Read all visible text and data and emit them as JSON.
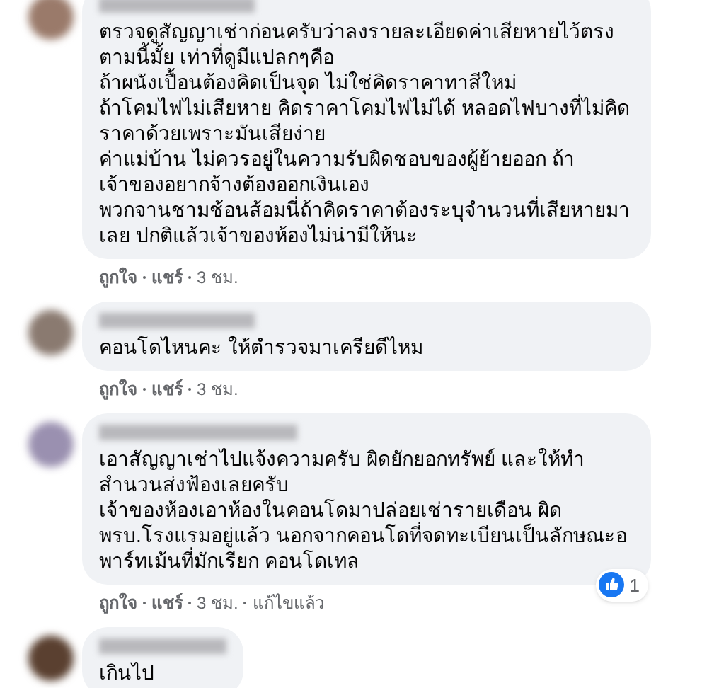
{
  "comments": [
    {
      "text": "ตรวจดูสัญญาเช่าก่อนครับว่าลงรายละเอียดค่าเสียหายไว้ตรงตามนี้มั้ย เท่าที่ดูมีแปลกๆคือ\nถ้าผนังเปื้อนต้องคิดเป็นจุด ไม่ใช่คิดราคาทาสีใหม่\nถ้าโคมไฟไม่เสียหาย คิดราคาโคมไฟไม่ได้ หลอดไฟบางที่ไม่คิดราคาด้วยเพราะมันเสียง่าย\nค่าแม่บ้าน ไม่ควรอยู่ในความรับผิดชอบของผู้ย้ายออก ถ้าเจ้าของอยากจ้างต้องออกเงินเอง\nพวกจานชามช้อนส้อมนี่ถ้าคิดราคาต้องระบุจำนวนที่เสียหายมาเลย ปกติแล้วเจ้าของห้องไม่น่ามีให้นะ",
      "actions": [
        {
          "label": "ถูกใจ",
          "kind": "link"
        },
        {
          "label": "แชร์",
          "kind": "link"
        },
        {
          "label": "3 ชม.",
          "kind": "time"
        }
      ]
    },
    {
      "text": "คอนโดไหนคะ ให้ตำรวจมาเครียดีไหม",
      "actions": [
        {
          "label": "ถูกใจ",
          "kind": "link"
        },
        {
          "label": "แชร์",
          "kind": "link"
        },
        {
          "label": "3 ชม.",
          "kind": "time"
        }
      ]
    },
    {
      "text": "เอาสัญญาเช่าไปแจ้งความครับ ผิดยักยอกทรัพย์ และให้ทำสำนวนส่งฟ้องเลยครับ\nเจ้าของห้องเอาห้องในคอนโดมาปล่อยเช่ารายเดือน ผิด\nพรบ.โรงแรมอยู่แล้ว นอกจากคอนโดที่จดทะเบียนเป็นลักษณะอพาร์ทเม้นที่มักเรียก คอนโดเทล",
      "reaction_count": "1",
      "actions": [
        {
          "label": "ถูกใจ",
          "kind": "link"
        },
        {
          "label": "แชร์",
          "kind": "link"
        },
        {
          "label": "3 ชม.",
          "kind": "time"
        },
        {
          "label": "แก้ไขแล้ว",
          "kind": "note"
        }
      ]
    },
    {
      "text": "เกินไป"
    }
  ]
}
